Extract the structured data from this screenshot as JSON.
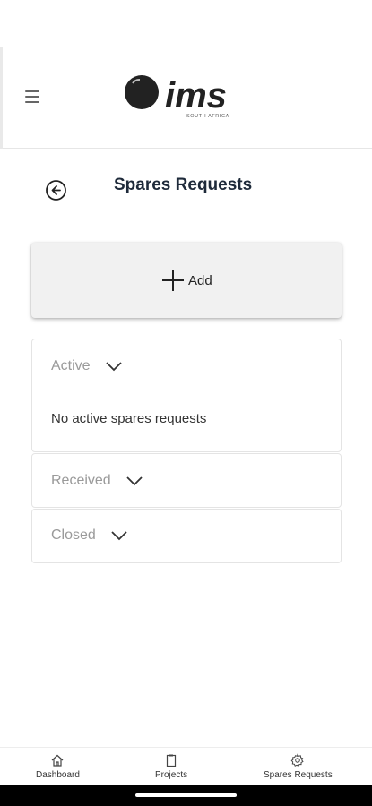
{
  "app": {
    "logo_text": "ims",
    "logo_subtext": "SOUTH AFRICA"
  },
  "page": {
    "title": "Spares Requests"
  },
  "add_card": {
    "label": "Add"
  },
  "sections": {
    "active": {
      "label": "Active",
      "empty_message": "No active spares requests"
    },
    "received": {
      "label": "Received"
    },
    "closed": {
      "label": "Closed"
    }
  },
  "bottom_nav": {
    "items": [
      {
        "label": "Dashboard",
        "icon": "home-icon"
      },
      {
        "label": "Projects",
        "icon": "clipboard-icon"
      },
      {
        "label": "Spares Requests",
        "icon": "gear-icon"
      }
    ]
  },
  "colors": {
    "title": "#1e2a3a",
    "section_label": "#9a9a9a",
    "add_card_bg": "#f1f1f1"
  }
}
